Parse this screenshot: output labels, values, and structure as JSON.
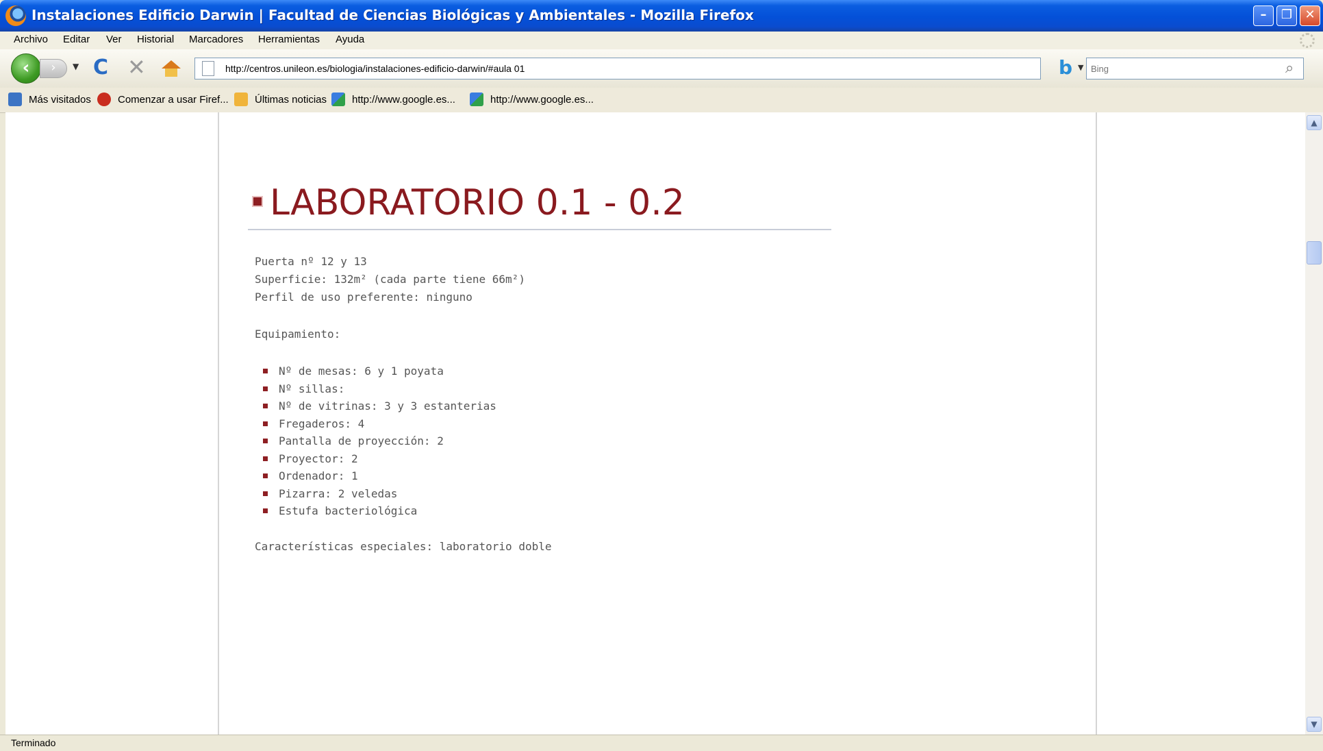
{
  "window": {
    "title": "Instalaciones Edificio Darwin | Facultad de Ciencias Biológicas y Ambientales - Mozilla Firefox"
  },
  "menubar": {
    "items": [
      "Archivo",
      "Editar",
      "Ver",
      "Historial",
      "Marcadores",
      "Herramientas",
      "Ayuda"
    ]
  },
  "toolbar": {
    "url": "http://centros.unileon.es/biologia/instalaciones-edificio-darwin/#aula 01",
    "search_placeholder": "Bing"
  },
  "bookmarks": {
    "items": [
      "Más visitados",
      "Comenzar a usar Firef...",
      "Últimas noticias",
      "http://www.google.es...",
      "http://www.google.es..."
    ]
  },
  "page": {
    "heading": "LABORATORIO 0.1 - 0.2",
    "info": [
      "Puerta nº 12 y 13",
      "Superficie: 132m² (cada parte tiene 66m²)",
      "Perfil de uso preferente: ninguno"
    ],
    "equipment_label": "Equipamiento:",
    "equipment": [
      "Nº de mesas: 6 y 1 poyata",
      "Nº sillas:",
      "Nº de vitrinas: 3 y 3 estanterias",
      "Fregaderos: 4",
      "Pantalla de proyección: 2",
      "Proyector: 2",
      "Ordenador: 1",
      "Pizarra: 2 veledas",
      "Estufa bacteriológica"
    ],
    "special": "Características especiales: laboratorio doble"
  },
  "status": {
    "text": "Terminado"
  },
  "colors": {
    "heading": "#8a1a1f",
    "bullet": "#8e1f23",
    "body_text": "#555555",
    "titlebar": "#0450d8"
  }
}
